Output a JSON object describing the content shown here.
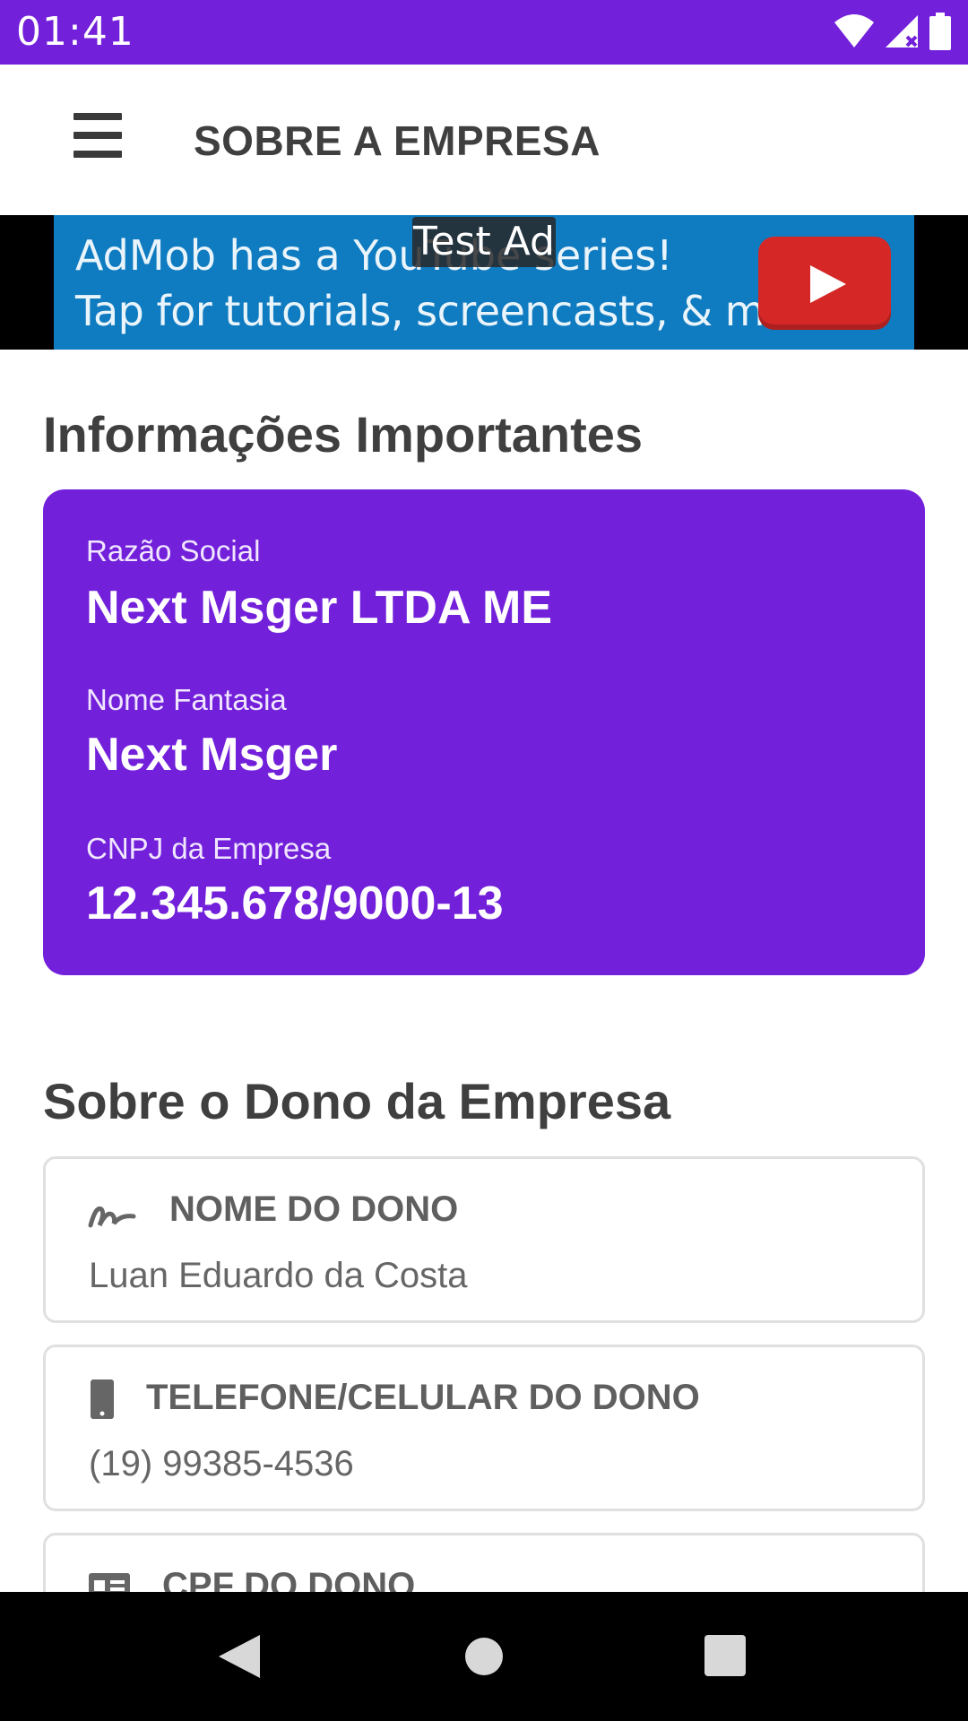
{
  "status_bar": {
    "time": "01:41",
    "icons": [
      "wifi-icon",
      "signal-icon",
      "battery-icon"
    ],
    "background": "#7220DA"
  },
  "toolbar": {
    "menu_icon": "menu-icon",
    "title": "SOBRE A EMPRESA"
  },
  "ad": {
    "line1": "AdMob has a YouTube series!",
    "line2": "Tap for tutorials, screencasts, & more.",
    "badge": "Test Ad",
    "icon": "youtube-play-icon"
  },
  "company_info": {
    "section_title": "Informações Importantes",
    "card_color": "#7220DA",
    "fields": [
      {
        "label": "Razão Social",
        "value": "Next Msger LTDA ME"
      },
      {
        "label": "Nome Fantasia",
        "value": "Next Msger"
      },
      {
        "label": "CNPJ da Empresa",
        "value": "12.345.678/9000-13"
      }
    ]
  },
  "owner_info": {
    "section_title": "Sobre o Dono da Empresa",
    "items": [
      {
        "icon": "signature-icon",
        "label": "NOME DO DONO",
        "value": "Luan Eduardo da Costa"
      },
      {
        "icon": "phone-icon",
        "label": "TELEFONE/CELULAR DO DONO",
        "value": "(19) 99385-4536"
      },
      {
        "icon": "id-card-icon",
        "label": "CPF DO DONO",
        "value": ""
      }
    ]
  },
  "nav_bar": {
    "buttons": [
      "back-icon",
      "home-icon",
      "recents-icon"
    ]
  }
}
